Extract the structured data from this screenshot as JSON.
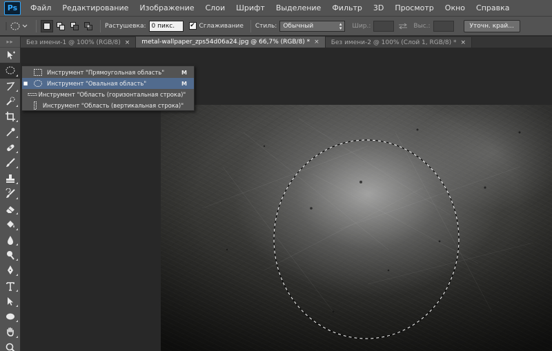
{
  "app": {
    "logo": "Ps"
  },
  "menu": [
    "Файл",
    "Редактирование",
    "Изображение",
    "Слои",
    "Шрифт",
    "Выделение",
    "Фильтр",
    "3D",
    "Просмотр",
    "Окно",
    "Справка"
  ],
  "options": {
    "feather_label": "Растушевка:",
    "feather_value": "0 пикс.",
    "antialias_label": "Сглаживание",
    "antialias_checked": true,
    "style_label": "Стиль:",
    "style_value": "Обычный",
    "width_label": "Шир.:",
    "height_label": "Выс.:",
    "refine_label": "Уточн. край..."
  },
  "tabs": [
    {
      "label": "Без имени-1 @ 100% (RGB/8)",
      "close": "×",
      "active": false
    },
    {
      "label": "metal-wallpaper_zps54d06a24.jpg @ 66,7% (RGB/8) *",
      "close": "×",
      "active": true
    },
    {
      "label": "Без имени-2 @ 100% (Слой 1, RGB/8) *",
      "close": "×",
      "active": false
    }
  ],
  "flyout": {
    "items": [
      {
        "label": "Инструмент \"Прямоугольная область\"",
        "shortcut": "M",
        "icon": "rect-marquee-icon",
        "selected": false
      },
      {
        "label": "Инструмент \"Овальная область\"",
        "shortcut": "M",
        "icon": "elliptical-marquee-icon",
        "selected": true
      },
      {
        "label": "Инструмент \"Область (горизонтальная строка)\"",
        "shortcut": "",
        "icon": "single-row-marquee-icon",
        "selected": false
      },
      {
        "label": "Инструмент \"Область (вертикальная строка)\"",
        "shortcut": "",
        "icon": "single-column-marquee-icon",
        "selected": false
      }
    ],
    "bullet": "■"
  },
  "tools": [
    "move-icon",
    "elliptical-marquee-icon",
    "lasso-icon",
    "quick-selection-icon",
    "crop-icon",
    "eyedropper-icon",
    "healing-brush-icon",
    "brush-icon",
    "clone-stamp-icon",
    "history-brush-icon",
    "eraser-icon",
    "paint-bucket-icon",
    "blur-icon",
    "dodge-icon",
    "pen-icon",
    "type-icon",
    "path-selection-icon",
    "ellipse-shape-icon",
    "hand-icon",
    "zoom-icon"
  ],
  "colors": {
    "accent": "#31a8ff",
    "selection": "#516b8e",
    "panel": "#535353",
    "workspace": "#282828"
  }
}
